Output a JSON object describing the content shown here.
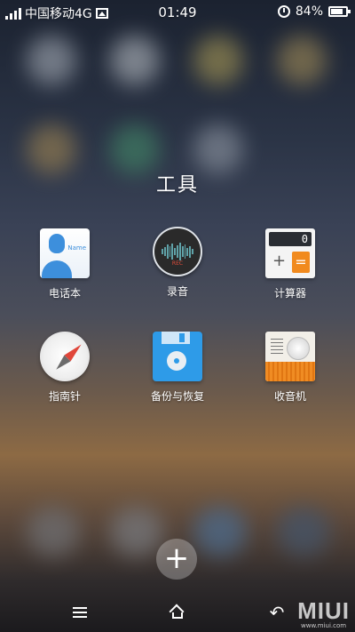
{
  "status_bar": {
    "carrier": "中国移动4G",
    "time": "01:49",
    "battery": "84%",
    "battery_level": 0.84,
    "icons": [
      "signal-icon",
      "image-icon",
      "alarm-icon",
      "battery-icon"
    ]
  },
  "folder": {
    "title": "工具",
    "apps": [
      {
        "label": "电话本",
        "icon": "contacts-icon"
      },
      {
        "label": "录音",
        "icon": "recorder-icon",
        "badge": "REC"
      },
      {
        "label": "计算器",
        "icon": "calculator-icon",
        "display": "0"
      },
      {
        "label": "指南针",
        "icon": "compass-icon"
      },
      {
        "label": "备份与恢复",
        "icon": "backup-icon"
      },
      {
        "label": "收音机",
        "icon": "radio-icon"
      }
    ],
    "contacts_text": "Name"
  },
  "add_button": {
    "label": "+"
  },
  "nav_bar": {
    "items": [
      "menu-icon",
      "home-icon",
      "back-icon"
    ]
  },
  "watermark": {
    "brand": "MIUI",
    "url": "www.miui.com"
  }
}
